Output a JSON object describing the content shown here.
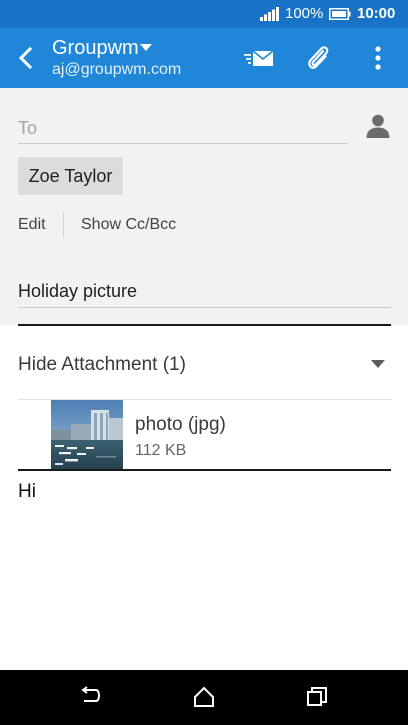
{
  "status_bar": {
    "battery_percent": "100%",
    "time": "10:00",
    "icons": [
      "signal-icon",
      "battery-icon"
    ]
  },
  "app_bar": {
    "account_name": "Groupwm",
    "account_email": "aj@groupwm.com",
    "icons": [
      "back-arrow-icon",
      "chevron-down-icon",
      "send-icon",
      "paperclip-icon",
      "more-vert-icon"
    ],
    "colors": {
      "status_bar": "#1873c6",
      "app_bar": "#1f86d8"
    }
  },
  "compose": {
    "to_placeholder": "To",
    "to_value": "",
    "recipient": "Zoe Taylor",
    "edit_label": "Edit",
    "cc_label": "Show Cc/Bcc",
    "subject_value": "Holiday picture",
    "contact_icon": "person-icon"
  },
  "attachments": {
    "toggle_label": "Hide Attachment (1)",
    "items": [
      {
        "name": "photo (jpg)",
        "size": "112 KB"
      }
    ]
  },
  "body": {
    "text": "Hi"
  },
  "nav_bar": {
    "icons": [
      "nav-back-icon",
      "home-icon",
      "recent-apps-icon"
    ]
  }
}
